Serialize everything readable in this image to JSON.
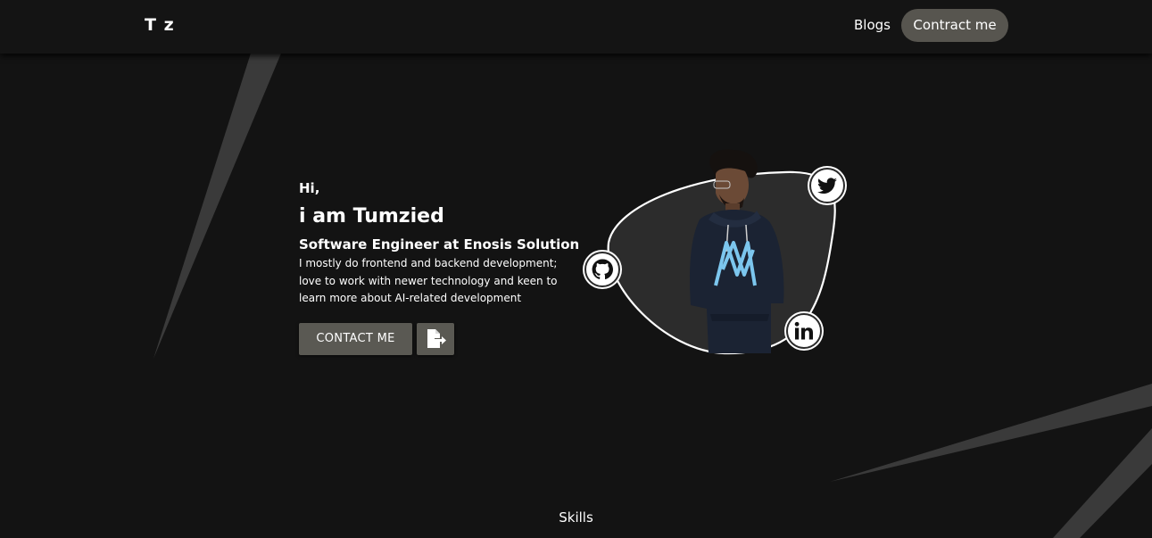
{
  "nav": {
    "logo": "T z",
    "blogs_label": "Blogs",
    "contract_label": "Contract me"
  },
  "hero": {
    "greeting": "Hi,",
    "name": "i am Tumzied",
    "role": "Software Engineer at Enosis Solution",
    "description": "I mostly do frontend and backend development; love to work with newer technology and keen to learn more about AI-related development",
    "contact_label": "CONTACT ME"
  },
  "profile": {
    "social_icons": [
      "twitter-icon",
      "github-icon",
      "linkedin-icon"
    ]
  },
  "sections": {
    "skills_label": "Skills"
  },
  "colors": {
    "background": "#131313",
    "navbar": "#141414",
    "button": "#5a5953",
    "pill": "#57554f",
    "blob": "#2c2c2c",
    "streak": "#3a3a3a",
    "text": "#ffffff"
  }
}
